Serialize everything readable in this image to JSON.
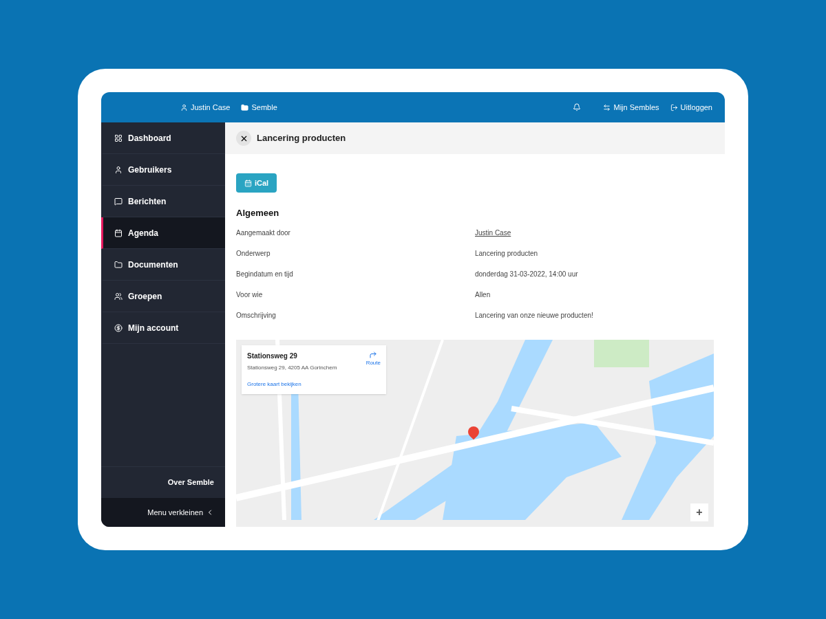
{
  "topbar": {
    "user": "Justin Case",
    "workspace": "Semble",
    "links": [
      {
        "kind": "switch",
        "label": "Mijn Sembles"
      },
      {
        "kind": "logout",
        "label": "Uitloggen"
      }
    ]
  },
  "sidebar": {
    "items": [
      {
        "label": "Dashboard",
        "selected": false
      },
      {
        "label": "Gebruikers",
        "selected": false
      },
      {
        "label": "Berichten",
        "selected": false
      },
      {
        "label": "Agenda",
        "selected": true
      },
      {
        "label": "Documenten",
        "selected": false
      },
      {
        "label": "Groepen",
        "selected": false
      },
      {
        "label": "Mijn account",
        "selected": false
      }
    ],
    "about": "Over Semble",
    "collapse": "Menu verkleinen"
  },
  "panel": {
    "title": "Lancering producten",
    "ical_button": "iCal",
    "section": "Algemeen",
    "fields": [
      {
        "label": "Aangemaakt door",
        "value": "Justin Case",
        "kind": "link"
      },
      {
        "label": "Onderwerp",
        "value": "Lancering producten",
        "kind": "text"
      },
      {
        "label": "Begindatum en tijd",
        "value": "donderdag 31-03-2022, 14:00 uur",
        "kind": "text"
      },
      {
        "label": "Voor wie",
        "value": "Allen",
        "kind": "text"
      },
      {
        "label": "Omschrijving",
        "value": "Lancering van onze nieuwe producten!",
        "kind": "text"
      }
    ],
    "map": {
      "place_title": "Stationsweg 29",
      "place_address": "Stationsweg 29, 4205 AA Gorinchem",
      "route": "Route",
      "larger_map": "Grotere kaart bekijken",
      "zoom_in": "+"
    }
  }
}
